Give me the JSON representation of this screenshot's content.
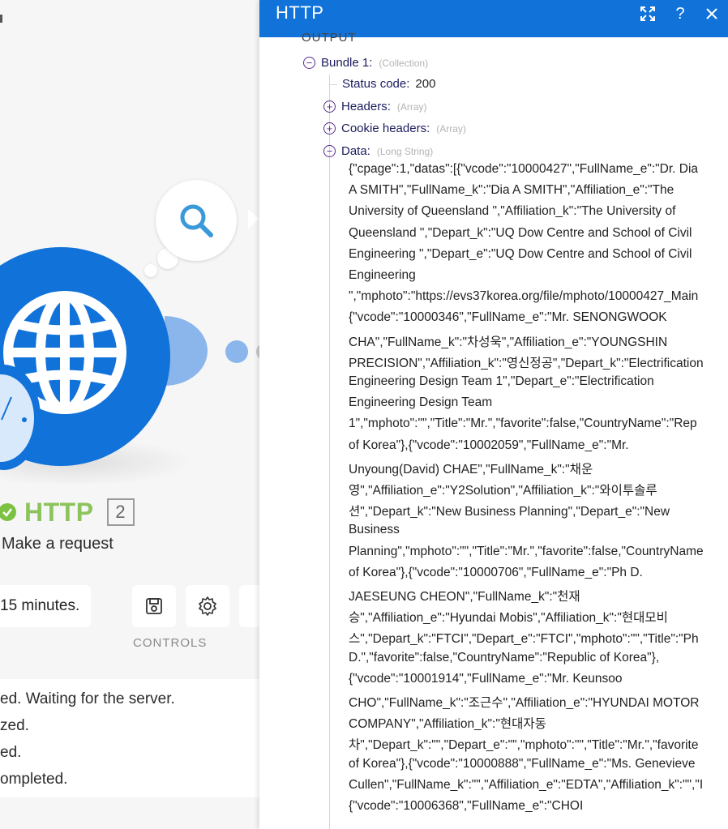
{
  "canvas": {
    "module": {
      "name": "HTTP",
      "count": "2",
      "subtitle": "Make a request",
      "icon": "globe-icon"
    },
    "schedule_text": "15 minutes.",
    "controls_label": "CONTROLS",
    "log_lines": [
      "ed. Waiting for the server.",
      "zed.",
      "ed.",
      "ompleted."
    ]
  },
  "panel": {
    "title": "HTTP",
    "section_label": "OUTPUT",
    "bundle": {
      "key": "Bundle 1:",
      "type": "(Collection)"
    },
    "status": {
      "key": "Status code:",
      "value": "200"
    },
    "headers": {
      "key": "Headers:",
      "type": "(Array)"
    },
    "cookie_headers": {
      "key": "Cookie headers:",
      "type": "(Array)"
    },
    "data": {
      "key": "Data:",
      "type": "(Long String)"
    },
    "data_lines": [
      "{\"cpage\":1,\"datas\":[{\"vcode\":\"10000427\",\"FullName_e\":\"Dr. Dia",
      "A SMITH\",\"FullName_k\":\"Dia A SMITH\",\"Affiliation_e\":\"The",
      "University of Queensland \",\"Affiliation_k\":\"The University of",
      "Queensland \",\"Depart_k\":\"UQ Dow Centre and School of Civil",
      "Engineering \",\"Depart_e\":\"UQ Dow Centre and School of Civil",
      "Engineering",
      "\",\"mphoto\":\"https://evs37korea.org/file/mphoto/10000427_Main",
      "{\"vcode\":\"10000346\",\"FullName_e\":\"Mr. SENONGWOOK",
      "CHA\",\"FullName_k\":\"차성욱\",\"Affiliation_e\":\"YOUNGSHIN",
      "PRECISION\",\"Affiliation_k\":\"영신정공\",\"Depart_k\":\"Electrification",
      "Engineering Design Team 1\",\"Depart_e\":\"Electrification",
      "Engineering Design Team",
      "1\",\"mphoto\":\"\",\"Title\":\"Mr.\",\"favorite\":false,\"CountryName\":\"Rep",
      "of Korea\"},{\"vcode\":\"10002059\",\"FullName_e\":\"Mr.",
      "Unyoung(David) CHAE\",\"FullName_k\":\"채운",
      "영\",\"Affiliation_e\":\"Y2Solution\",\"Affiliation_k\":\"와이투솔루",
      "션\",\"Depart_k\":\"New Business Planning\",\"Depart_e\":\"New",
      "Business",
      "Planning\",\"mphoto\":\"\",\"Title\":\"Mr.\",\"favorite\":false,\"CountryName",
      "of Korea\"},{\"vcode\":\"10000706\",\"FullName_e\":\"Ph D.",
      "JAESEUNG CHEON\",\"FullName_k\":\"천재",
      "승\",\"Affiliation_e\":\"Hyundai Mobis\",\"Affiliation_k\":\"현대모비",
      "스\",\"Depart_k\":\"FTCI\",\"Depart_e\":\"FTCI\",\"mphoto\":\"\",\"Title\":\"Ph",
      "D.\",\"favorite\":false,\"CountryName\":\"Republic of Korea\"},",
      "{\"vcode\":\"10001914\",\"FullName_e\":\"Mr. Keunsoo",
      "CHO\",\"FullName_k\":\"조근수\",\"Affiliation_e\":\"HYUNDAI MOTOR",
      "COMPANY\",\"Affiliation_k\":\"현대자동",
      "차\",\"Depart_k\":\"\",\"Depart_e\":\"\",\"mphoto\":\"\",\"Title\":\"Mr.\",\"favorite",
      "of Korea\"},{\"vcode\":\"10000888\",\"FullName_e\":\"Ms. Genevieve",
      "Cullen\",\"FullName_k\":\"\",\"Affiliation_e\":\"EDTA\",\"Affiliation_k\":\"\",\"I",
      "{\"vcode\":\"10006368\",\"FullName_e\":\"CHOI"
    ]
  },
  "colors": {
    "brand_blue": "#1172d9",
    "light_blue": "#8ab6ec",
    "success_green": "#7cc242",
    "tree_purple": "#5a2a8c"
  }
}
